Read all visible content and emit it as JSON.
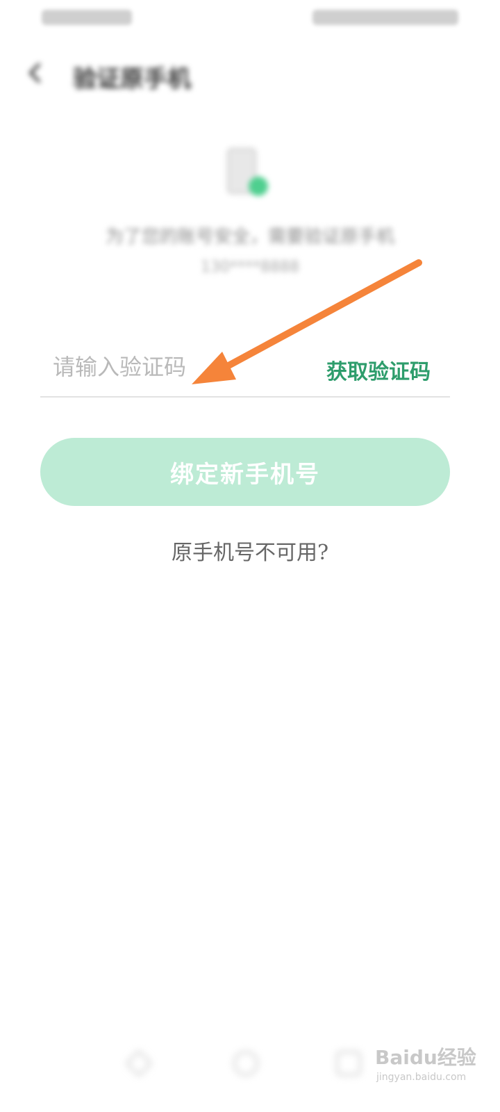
{
  "header": {
    "title": "验证原手机"
  },
  "hero": {
    "description": "为了您的账号安全，需要验证原手机",
    "masked_number": "130****8888"
  },
  "verification": {
    "placeholder": "请输入验证码",
    "get_code_label": "获取验证码"
  },
  "bind_button": {
    "label": "绑定新手机号"
  },
  "unavailable_link": {
    "label": "原手机号不可用?"
  },
  "watermark": {
    "logo_text": "Baidu经验",
    "url": "jingyan.baidu.com"
  },
  "colors": {
    "accent_green": "#2e9d6c",
    "button_bg": "#bdebd5",
    "arrow_orange": "#f5843a"
  },
  "icons": {
    "back": "arrow-left-icon",
    "phone": "phone-check-icon"
  }
}
